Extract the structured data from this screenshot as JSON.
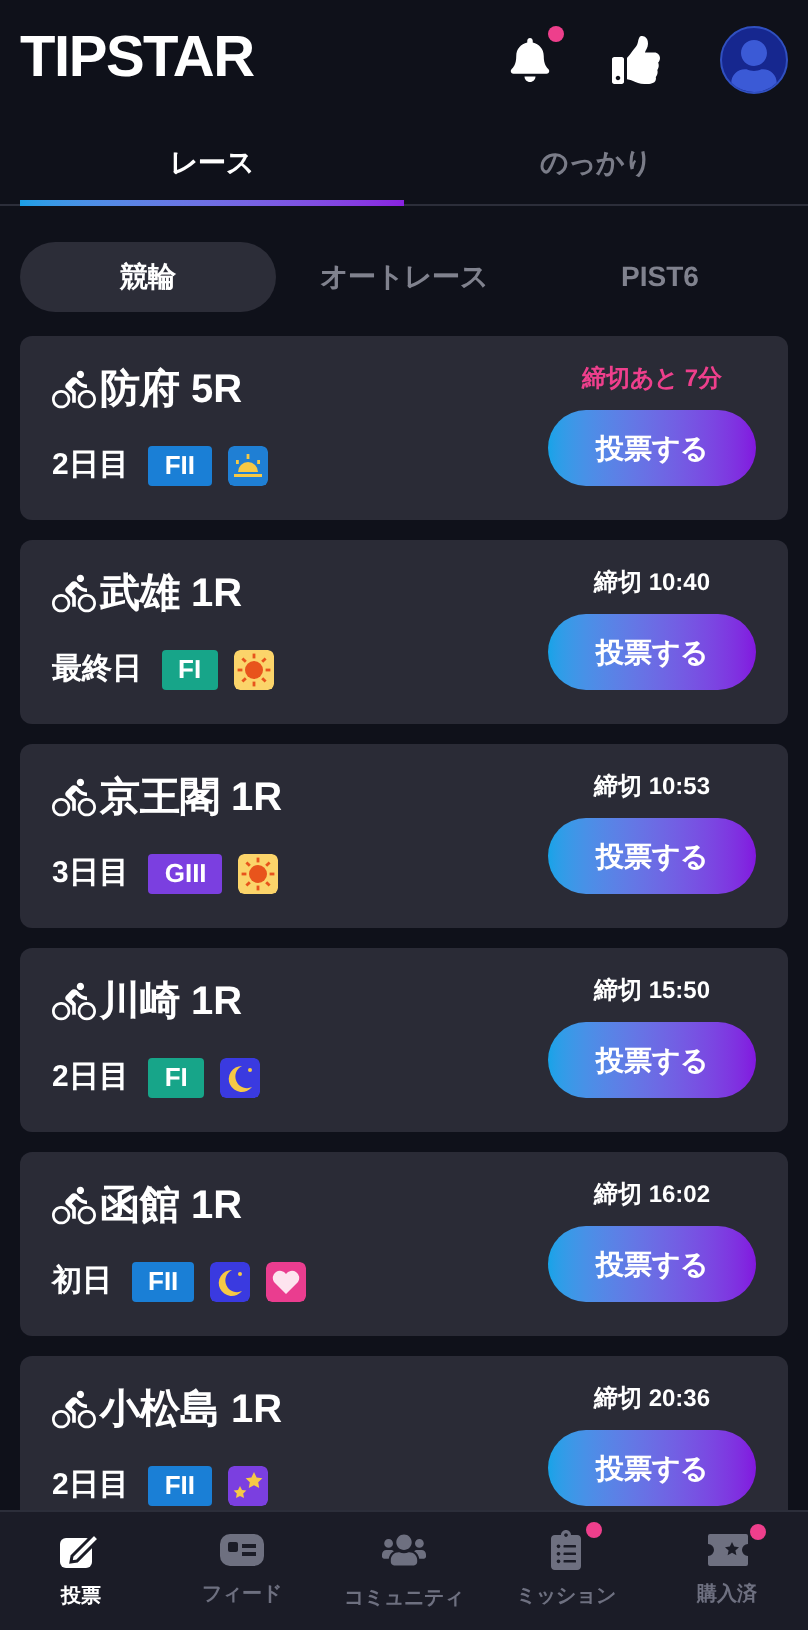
{
  "header": {
    "logo": "TIPSTAR",
    "notification_badge": true
  },
  "tabs": [
    {
      "label": "レース",
      "selected": true
    },
    {
      "label": "のっかり",
      "selected": false
    }
  ],
  "segments": [
    {
      "label": "競輪",
      "selected": true
    },
    {
      "label": "オートレース",
      "selected": false
    },
    {
      "label": "PIST6",
      "selected": false
    }
  ],
  "races": [
    {
      "title": "防府 5R",
      "day": "2日目",
      "grade": {
        "label": "FII",
        "color": "#1a7fd6"
      },
      "icons": [
        {
          "kind": "morning"
        }
      ],
      "deadline": "締切あと 7分",
      "urgent": true,
      "button": "投票する"
    },
    {
      "title": "武雄 1R",
      "day": "最終日",
      "grade": {
        "label": "FI",
        "color": "#17a589"
      },
      "icons": [
        {
          "kind": "day"
        }
      ],
      "deadline": "締切 10:40",
      "urgent": false,
      "button": "投票する"
    },
    {
      "title": "京王閣 1R",
      "day": "3日目",
      "grade": {
        "label": "GIII",
        "color": "#7b3fe0"
      },
      "icons": [
        {
          "kind": "day"
        }
      ],
      "deadline": "締切 10:53",
      "urgent": false,
      "button": "投票する"
    },
    {
      "title": "川崎 1R",
      "day": "2日目",
      "grade": {
        "label": "FI",
        "color": "#17a589"
      },
      "icons": [
        {
          "kind": "night"
        }
      ],
      "deadline": "締切 15:50",
      "urgent": false,
      "button": "投票する"
    },
    {
      "title": "函館 1R",
      "day": "初日",
      "grade": {
        "label": "FII",
        "color": "#1a7fd6"
      },
      "icons": [
        {
          "kind": "night"
        },
        {
          "kind": "girls"
        }
      ],
      "deadline": "締切 16:02",
      "urgent": false,
      "button": "投票する"
    },
    {
      "title": "小松島 1R",
      "day": "2日目",
      "grade": {
        "label": "FII",
        "color": "#1a7fd6"
      },
      "icons": [
        {
          "kind": "midnight"
        }
      ],
      "deadline": "締切 20:36",
      "urgent": false,
      "button": "投票する"
    }
  ],
  "nav": [
    {
      "label": "投票",
      "kind": "vote",
      "selected": true,
      "badge": false
    },
    {
      "label": "フィード",
      "kind": "feed",
      "selected": false,
      "badge": false
    },
    {
      "label": "コミュニティ",
      "kind": "community",
      "selected": false,
      "badge": false
    },
    {
      "label": "ミッション",
      "kind": "mission",
      "selected": false,
      "badge": true
    },
    {
      "label": "購入済",
      "kind": "purchased",
      "selected": false,
      "badge": true
    }
  ]
}
